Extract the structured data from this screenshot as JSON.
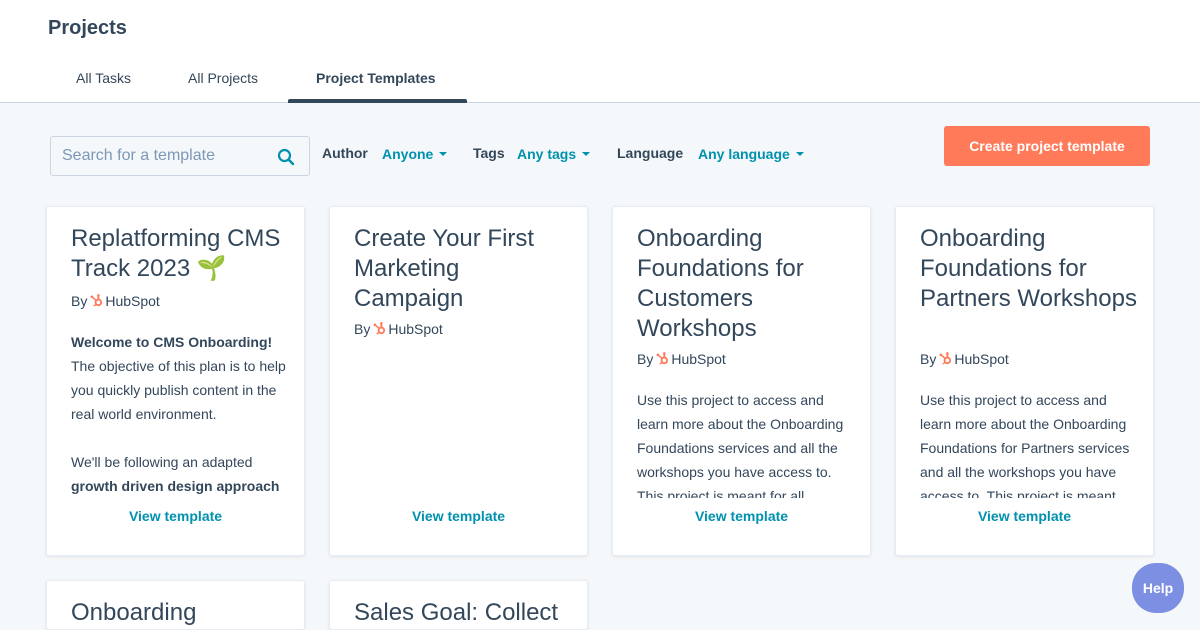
{
  "header": {
    "title": "Projects",
    "tabs": [
      {
        "label": "All Tasks"
      },
      {
        "label": "All Projects"
      },
      {
        "label": "Project Templates"
      }
    ]
  },
  "filters": {
    "search_placeholder": "Search for a template",
    "author_label": "Author",
    "author_value": "Anyone",
    "tags_label": "Tags",
    "tags_value": "Any tags",
    "language_label": "Language",
    "language_value": "Any language"
  },
  "create_button": "Create project template",
  "cards": [
    {
      "title": "Replatforming CMS Track 2023 🌱",
      "by": "By",
      "author": "HubSpot",
      "desc_bold": "Welcome to CMS Onboarding!",
      "desc": "The objective of this plan is to help you quickly publish content in the real world environment.",
      "desc2": "We'll be following an adapted",
      "desc2_bold": "growth driven design approach",
      "link": "View template"
    },
    {
      "title": "Create Your First Marketing Campaign",
      "by": "By",
      "author": "HubSpot",
      "link": "View template"
    },
    {
      "title": "Onboarding Foundations for Customers Workshops",
      "by": "By",
      "author": "HubSpot",
      "desc": "Use this project to access and learn more about the Onboarding Foundations services and all the workshops you have access to. This project is meant for all",
      "link": "View template"
    },
    {
      "title": "Onboarding Foundations for Partners Workshops",
      "by": "By",
      "author": "HubSpot",
      "desc": "Use this project to access and learn more about the Onboarding Foundations for Partners services and all the workshops you have access to. This project is meant",
      "link": "View template"
    },
    {
      "title": "Onboarding"
    },
    {
      "title": "Sales Goal: Collect"
    }
  ],
  "help_button": "Help",
  "colors": {
    "accent": "#0091ae",
    "primary_button": "#ff7a59",
    "text": "#33475b",
    "help": "#7c8fe3"
  }
}
